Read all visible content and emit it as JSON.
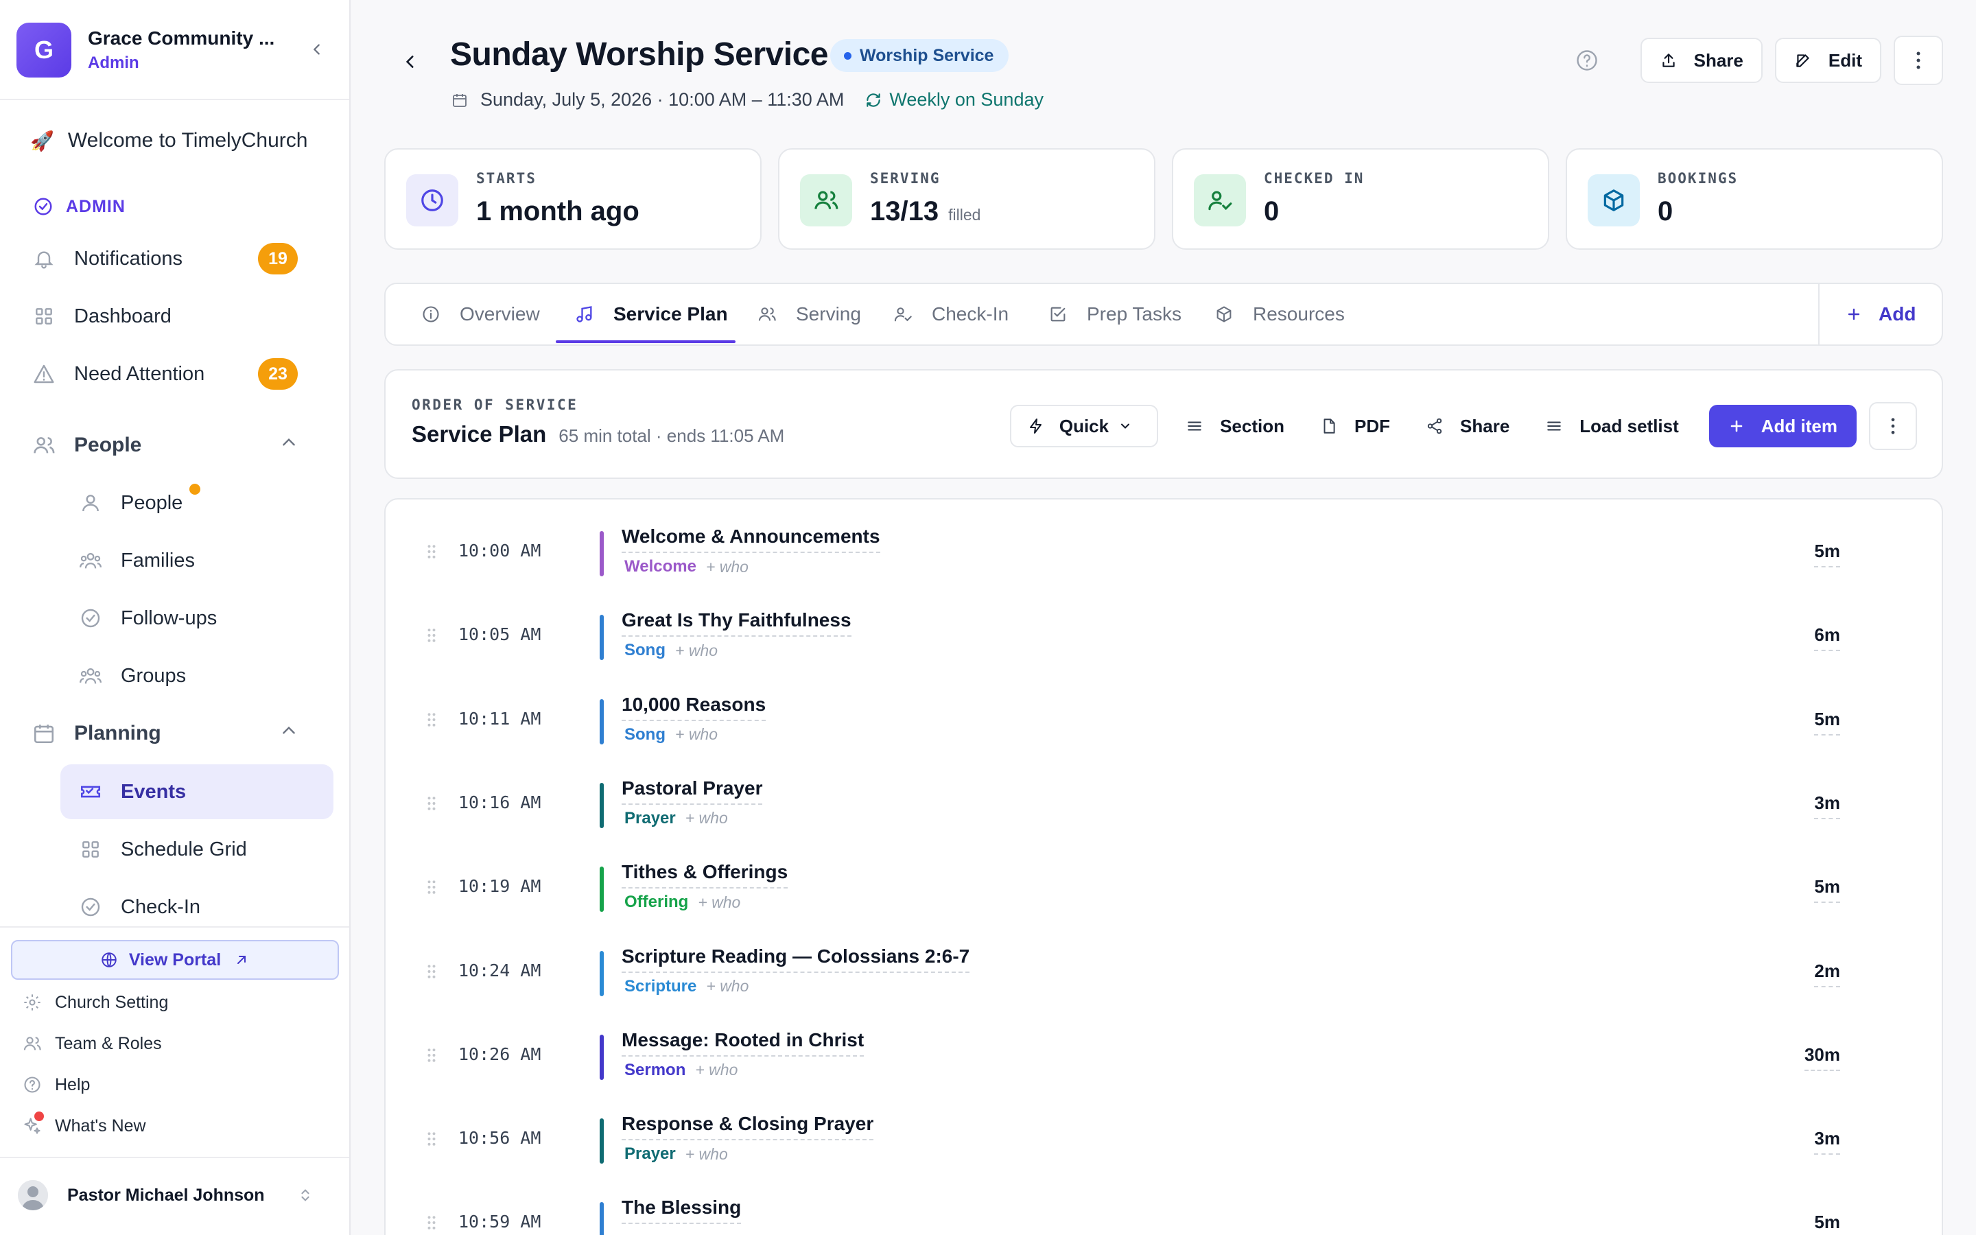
{
  "sidebar": {
    "org_initial": "G",
    "org_name": "Grace Community ...",
    "org_role": "Admin",
    "welcome": "Welcome to TimelyChurch",
    "admin_label": "ADMIN",
    "notifications": {
      "label": "Notifications",
      "badge": "19"
    },
    "dashboard": "Dashboard",
    "need_attention": {
      "label": "Need Attention",
      "badge": "23"
    },
    "people_section": "People",
    "people_items": [
      "People",
      "Families",
      "Follow-ups",
      "Groups"
    ],
    "planning_section": "Planning",
    "planning_items": [
      "Events",
      "Schedule Grid",
      "Check-In"
    ],
    "view_portal": "View Portal",
    "church_setting": "Church Setting",
    "team_roles": "Team & Roles",
    "help": "Help",
    "whats_new": "What's New",
    "user_name": "Pastor Michael Johnson"
  },
  "header": {
    "title": "Sunday Worship Service",
    "type_pill": "Worship Service",
    "datetime": "Sunday, July 5, 2026 · 10:00 AM – 11:30 AM",
    "recurrence": "Weekly on Sunday",
    "share": "Share",
    "edit": "Edit"
  },
  "stats": [
    {
      "label": "STARTS",
      "value": "1 month ago",
      "suffix": ""
    },
    {
      "label": "SERVING",
      "value": "13/13",
      "suffix": "filled"
    },
    {
      "label": "CHECKED IN",
      "value": "0",
      "suffix": ""
    },
    {
      "label": "BOOKINGS",
      "value": "0",
      "suffix": ""
    }
  ],
  "tabs": [
    "Overview",
    "Service Plan",
    "Serving",
    "Check-In",
    "Prep Tasks",
    "Resources"
  ],
  "tab_add": "Add",
  "plan": {
    "eyebrow": "ORDER OF SERVICE",
    "title": "Service Plan",
    "meta": "65 min total · ends 11:05 AM",
    "quick": "Quick",
    "section": "Section",
    "pdf": "PDF",
    "share": "Share",
    "load_setlist": "Load setlist",
    "add_item": "Add item"
  },
  "items": [
    {
      "time": "10:00 AM",
      "title": "Welcome & Announcements",
      "tag": "Welcome",
      "who": "+ who",
      "duration": "5m",
      "color": "#9b59c9"
    },
    {
      "time": "10:05 AM",
      "title": "Great Is Thy Faithfulness",
      "tag": "Song",
      "who": "+ who",
      "duration": "6m",
      "color": "#2f7fd1"
    },
    {
      "time": "10:11 AM",
      "title": "10,000 Reasons",
      "tag": "Song",
      "who": "+ who",
      "duration": "5m",
      "color": "#2f7fd1"
    },
    {
      "time": "10:16 AM",
      "title": "Pastoral Prayer",
      "tag": "Prayer",
      "who": "+ who",
      "duration": "3m",
      "color": "#0f6b72"
    },
    {
      "time": "10:19 AM",
      "title": "Tithes & Offerings",
      "tag": "Offering",
      "who": "+ who",
      "duration": "5m",
      "color": "#16a34a"
    },
    {
      "time": "10:24 AM",
      "title": "Scripture Reading — Colossians 2:6-7",
      "tag": "Scripture",
      "who": "+ who",
      "duration": "2m",
      "color": "#2a8ad4"
    },
    {
      "time": "10:26 AM",
      "title": "Message: Rooted in Christ",
      "tag": "Sermon",
      "who": "+ who",
      "duration": "30m",
      "color": "#4338ca"
    },
    {
      "time": "10:56 AM",
      "title": "Response & Closing Prayer",
      "tag": "Prayer",
      "who": "+ who",
      "duration": "3m",
      "color": "#0f6b72"
    },
    {
      "time": "10:59 AM",
      "title": "The Blessing",
      "tag": "",
      "who": "",
      "duration": "5m",
      "color": "#2f7fd1"
    }
  ]
}
